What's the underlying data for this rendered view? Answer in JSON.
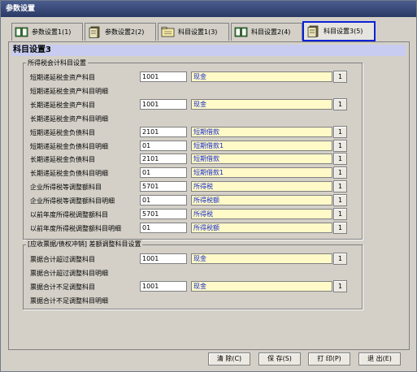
{
  "window": {
    "title": "参数设置"
  },
  "tabs": [
    {
      "label": "参数设置1(1)",
      "icon": "book-icon"
    },
    {
      "label": "参数设置2(2)",
      "icon": "ledger-icon"
    },
    {
      "label": "科目设置1(3)",
      "icon": "folder-icon"
    },
    {
      "label": "科目设置2(4)",
      "icon": "book-icon"
    },
    {
      "label": "科目设置3(5)",
      "icon": "ledger-icon",
      "active": true
    }
  ],
  "section": {
    "title": "科目设置3"
  },
  "group1": {
    "legend": "所得税会计科目设置",
    "rows": [
      {
        "label": "短期递延税金资产科目",
        "code": "1001",
        "name": "现金"
      },
      {
        "label": "短期递延税金资产科目明细"
      },
      {
        "label": "长期递延税金资产科目",
        "code": "1001",
        "name": "现金"
      },
      {
        "label": "长期递延税金资产科目明细"
      },
      {
        "label": "短期递延税金负债科目",
        "code": "2101",
        "name": "短期借款"
      },
      {
        "label": "短期递延税金负债科目明细",
        "code": "01",
        "name": "短期借款1"
      },
      {
        "label": "长期递延税金负债科目",
        "code": "2101",
        "name": "短期借款"
      },
      {
        "label": "长期递延税金负债科目明细",
        "code": "01",
        "name": "短期借款1"
      },
      {
        "label": "企业所得税等调整额科目",
        "code": "5701",
        "name": "所得税"
      },
      {
        "label": "企业所得税等调整额科目明细",
        "code": "01",
        "name": "所得税额"
      },
      {
        "label": "以前年度所得税调整额科目",
        "code": "5701",
        "name": "所得税"
      },
      {
        "label": "以前年度所得税调整额科目明细",
        "code": "01",
        "name": "所得税额"
      }
    ]
  },
  "group2": {
    "legend": "[应收票据/债权冲销] 差额调整科目设置",
    "rows": [
      {
        "label": "票据合计超过调整科目",
        "code": "1001",
        "name": "现金"
      },
      {
        "label": "票据合计超过调整科目明细"
      },
      {
        "label": "票据合计不足调整科目",
        "code": "1001",
        "name": "现金"
      },
      {
        "label": "票据合计不足调整科目明细"
      }
    ]
  },
  "pick_label": "1",
  "buttons": {
    "clear": "清 除(C)",
    "save": "保 存(S)",
    "print": "打 印(P)",
    "exit": "退 出(E)"
  },
  "colors": {
    "active_tab_border": "#0b22d8",
    "section_head": "#c8ccf0",
    "name_field_bg": "#fffac8",
    "name_field_text": "#1428c8"
  }
}
